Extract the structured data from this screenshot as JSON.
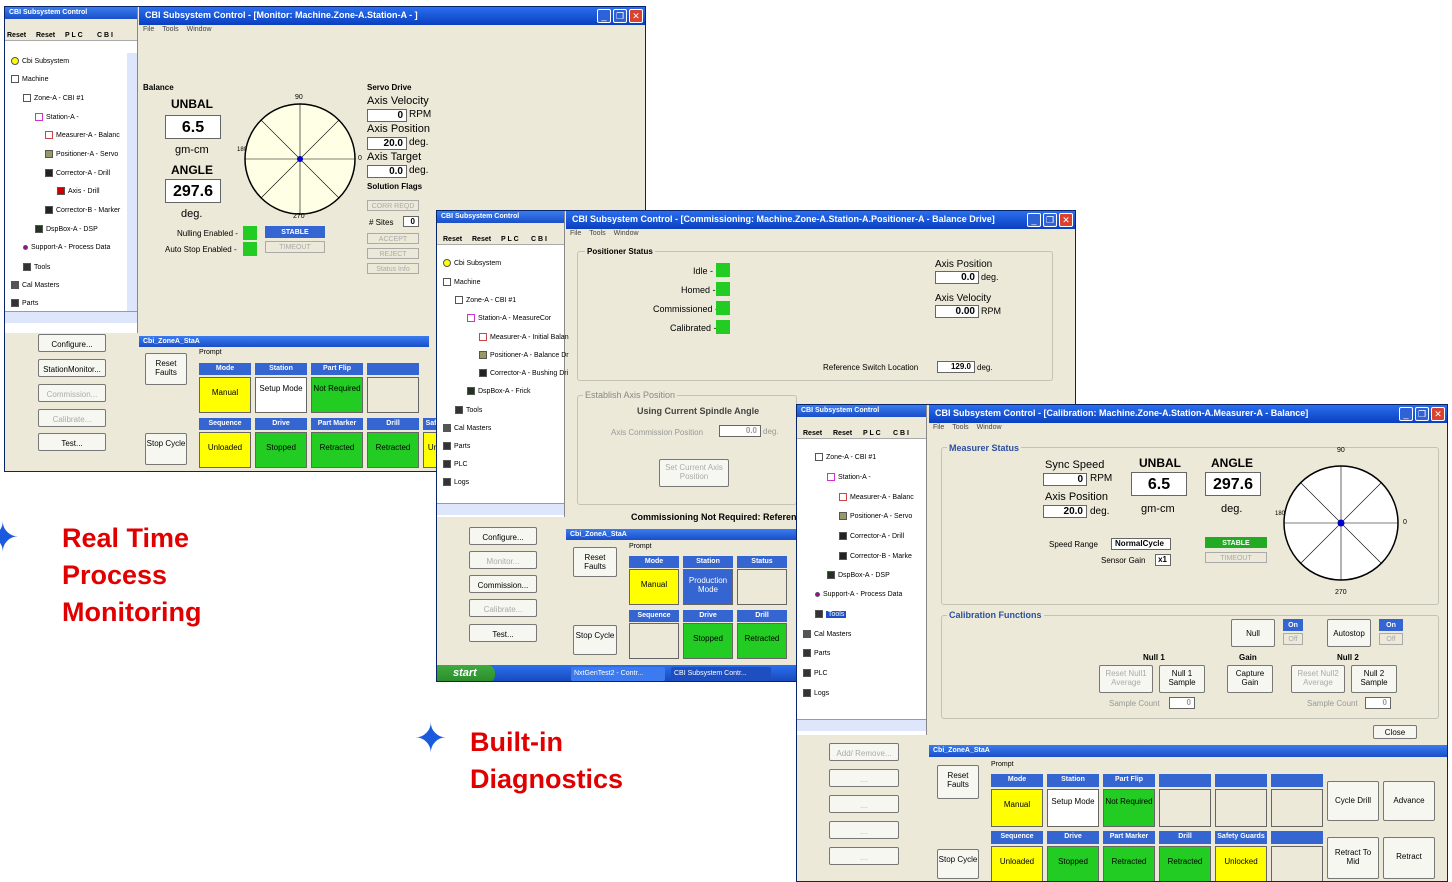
{
  "left_tree_title": "CBI Subsystem Control",
  "tools": [
    "Reset",
    "Reset",
    "P L C",
    "C B I"
  ],
  "win1": {
    "title": "CBI Subsystem Control - [Monitor: Machine.Zone-A.Station-A - ]",
    "menu": [
      "File",
      "Tools",
      "Window"
    ],
    "tree": [
      "Cbi Subsystem",
      "Machine",
      "Zone-A - CBI #1",
      "Station-A -",
      "Measurer-A - Balanc",
      "Positioner-A - Servo",
      "Corrector-A - Drill",
      "Axis - Drill",
      "Corrector-B - Marker",
      "DspBox-A - DSP",
      "Support-A - Process Data",
      "Tools",
      "Cal Masters",
      "Parts"
    ],
    "side_buttons": [
      "Configure...",
      "StationMonitor...",
      "Commission...",
      "Calibrate...",
      "Test..."
    ],
    "balance": {
      "section": "Balance",
      "unbal_label": "UNBAL",
      "unbal": "6.5",
      "unit1": "gm-cm",
      "angle_label": "ANGLE",
      "angle": "297.6",
      "unit2": "deg.",
      "dial_top": "90",
      "dial_bottom": "270",
      "dial_right": "0",
      "dial_left": "180",
      "nulling": "Nulling Enabled -",
      "autostop": "Auto Stop Enabled -",
      "stable": "STABLE",
      "timeout": "TIMEOUT"
    },
    "servo": {
      "section": "Servo Drive",
      "vel_label": "Axis Velocity",
      "vel": "0",
      "vel_unit": "RPM",
      "pos_label": "Axis Position",
      "pos": "20.0",
      "pos_unit": "deg.",
      "tgt_label": "Axis Target",
      "tgt": "0.0",
      "tgt_unit": "deg.",
      "flags": "Solution Flags",
      "corr": "CORR REQD",
      "sites_label": "# Sites",
      "sites": "0",
      "accept": "ACCEPT",
      "reject": "REJECT",
      "status": "Status Info"
    },
    "station_bar": "Cbi_ZoneA_StaA",
    "prompt": "Prompt",
    "reset_faults": "Reset Faults",
    "stop_cycle": "Stop Cycle",
    "row1_headers": [
      "Mode",
      "Station",
      "Part Flip",
      ""
    ],
    "row1_cells": [
      "Manual",
      "Setup Mode",
      "Not Required",
      ""
    ],
    "row2_headers": [
      "Sequence",
      "Drive",
      "Part Marker",
      "Drill",
      "Safe"
    ],
    "row2_cells": [
      "Unloaded",
      "Stopped",
      "Retracted",
      "Retracted",
      "Un"
    ]
  },
  "win2": {
    "title": "CBI Subsystem Control - [Commissioning: Machine.Zone-A.Station-A.Positioner-A - Balance Drive]",
    "menu": [
      "File",
      "Tools",
      "Window"
    ],
    "tree": [
      "Cbi Subsystem",
      "Machine",
      "Zone-A - CBI #1",
      "Station-A - MeasureCor",
      "Measurer-A - Initial Balan",
      "Positioner-A - Balance Dr",
      "Corrector-A - Bushing Dri",
      "DspBox-A - Frick",
      "Tools",
      "Cal Masters",
      "Parts",
      "PLC",
      "Logs"
    ],
    "side_buttons": [
      "Configure...",
      "Monitor...",
      "Commission...",
      "Calibrate...",
      "Test..."
    ],
    "positioner": {
      "section": "Positioner Status",
      "states": [
        "Idle -",
        "Homed -",
        "Commissioned -",
        "Calibrated -"
      ],
      "pos_label": "Axis Position",
      "pos": "0.0",
      "pos_unit": "deg.",
      "vel_label": "Axis Velocity",
      "vel": "0.00",
      "vel_unit": "RPM",
      "ref_label": "Reference Switch Location",
      "ref": "129.0",
      "ref_unit": "deg."
    },
    "establish": {
      "section": "Establish Axis Position",
      "spindle": "Using Current Spindle Angle",
      "comm_label": "Axis Commission Position",
      "comm": "0.0",
      "comm_unit": "deg.",
      "set_btn": "Set Current Axis Position"
    },
    "commissioning_note": "Commissioning Not Required: Reference",
    "station_bar": "Cbi_ZoneA_StaA",
    "prompt": "Prompt",
    "reset_faults": "Reset Faults",
    "stop_cycle": "Stop Cycle",
    "row1_headers": [
      "Mode",
      "Station",
      "Status"
    ],
    "row1_cells": [
      "Manual",
      "Production Mode",
      ""
    ],
    "row2_headers": [
      "Sequence",
      "Drive",
      "Drill"
    ],
    "row2_cells": [
      "",
      "Stopped",
      "Retracted"
    ],
    "taskbar": {
      "start": "start",
      "items": [
        "NxtGenTest2 - Contr...",
        "CBI Subsystem Contr..."
      ]
    }
  },
  "win3": {
    "title": "CBI Subsystem Control - [Calibration: Machine.Zone-A.Station-A.Measurer-A - Balance]",
    "menu": [
      "File",
      "Tools",
      "Window"
    ],
    "tree": [
      "Zone-A - CBI #1",
      "Station-A -",
      "Measurer-A - Balanc",
      "Positioner-A - Servo",
      "Corrector-A - Drill",
      "Corrector-B - Marke",
      "DspBox-A - DSP",
      "Support-A - Process Data",
      "Tools",
      "Cal Masters",
      "Parts",
      "PLC",
      "Logs"
    ],
    "side_buttons": [
      "Add/ Remove...",
      "...",
      "...",
      "...",
      "..."
    ],
    "measurer": {
      "section": "Measurer Status",
      "sync_label": "Sync Speed",
      "sync": "0",
      "sync_unit": "RPM",
      "pos_label": "Axis Position",
      "pos": "20.0",
      "pos_unit": "deg.",
      "unbal_label": "UNBAL",
      "unbal": "6.5",
      "unit1": "gm-cm",
      "angle_label": "ANGLE",
      "angle": "297.6",
      "unit2": "deg.",
      "range_label": "Speed Range",
      "range": "NormalCycle",
      "gain_label": "Sensor Gain",
      "gain": "x1",
      "stable": "STABLE",
      "timeout": "TIMEOUT",
      "dial_top": "90",
      "dial_bottom": "270",
      "dial_right": "0",
      "dial_left": "180"
    },
    "cal": {
      "section": "Calibration Functions",
      "null_btn": "Null",
      "on": "On",
      "off": "Off",
      "autostop_btn": "Autostop",
      "null1": "Null 1",
      "gain": "Gain",
      "null2": "Null 2",
      "reset_null1": "Reset Null1 Average",
      "null1_sample": "Null 1 Sample",
      "capture": "Capture Gain",
      "reset_null2": "Reset Null2 Average",
      "null2_sample": "Null 2 Sample",
      "sample_count": "Sample Count",
      "sc1": "0",
      "sc2": "0",
      "close": "Close"
    },
    "station_bar": "Cbi_ZoneA_StaA",
    "prompt": "Prompt",
    "reset_faults": "Reset Faults",
    "stop_cycle": "Stop Cycle",
    "row1_headers": [
      "Mode",
      "Station",
      "Part Flip",
      "",
      "",
      ""
    ],
    "row1_cells": [
      "Manual",
      "Setup Mode",
      "Not Required",
      "",
      "",
      ""
    ],
    "row2_headers": [
      "Sequence",
      "Drive",
      "Part Marker",
      "Drill",
      "Safety Guards",
      ""
    ],
    "row2_cells": [
      "Unloaded",
      "Stopped",
      "Retracted",
      "Retracted",
      "Unlocked",
      ""
    ],
    "right_buttons": [
      "Cycle Drill",
      "Advance",
      "Retract To Mid",
      "Retract"
    ]
  },
  "captions": {
    "c1": [
      "Real Time",
      "Process",
      "Monitoring"
    ],
    "c2": [
      "Built-in",
      "Diagnostics"
    ]
  },
  "colors": {
    "title_blue": "#0a3fbf",
    "status_yellow": "#ffff00",
    "status_green": "#22cc22",
    "caption_red": "#e00000",
    "star_blue": "#1a5adf"
  }
}
